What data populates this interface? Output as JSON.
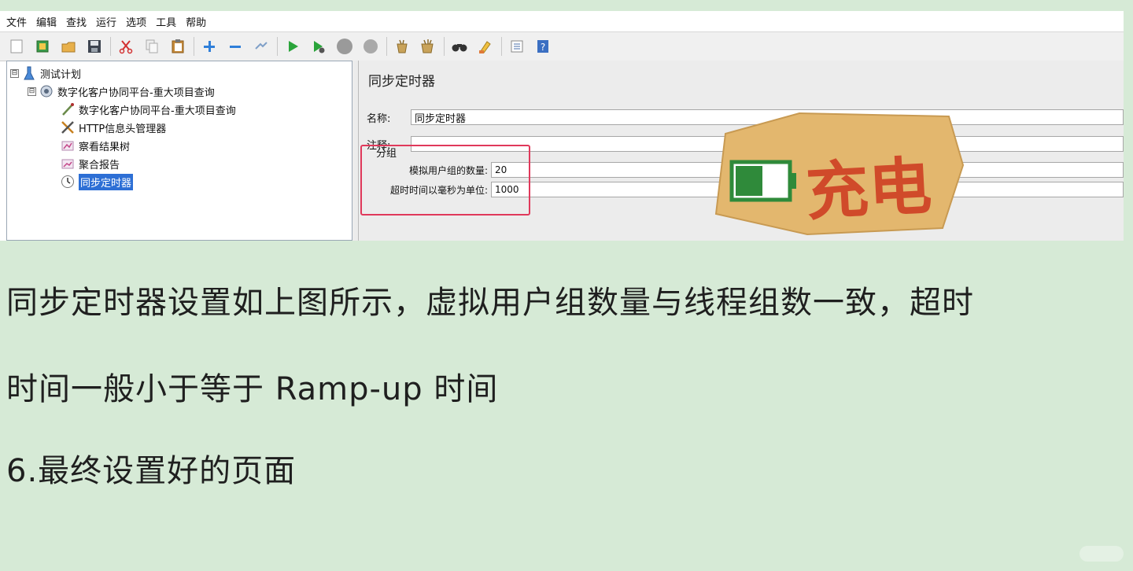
{
  "menu": [
    "文件",
    "编辑",
    "查找",
    "运行",
    "选项",
    "工具",
    "帮助"
  ],
  "toolbar_icons": [
    "new-icon",
    "templates-icon",
    "open-icon",
    "save-icon",
    "cut-icon",
    "copy-icon",
    "paste-icon",
    "expand-icon",
    "collapse-icon",
    "toggle-icon",
    "start-icon",
    "start-no-pause-icon",
    "stop-icon",
    "shutdown-icon",
    "clear-icon",
    "clear-all-icon",
    "search-icon",
    "reset-search-icon",
    "function-helper-icon",
    "help-icon"
  ],
  "tree": {
    "items": [
      {
        "label": "测试计划",
        "icon": "test-plan-icon",
        "expander": "⊟"
      },
      {
        "label": "数字化客户协同平台-重大项目查询",
        "icon": "thread-group-icon",
        "expander": "⊟"
      },
      {
        "label": "数字化客户协同平台-重大项目查询",
        "icon": "http-sampler-icon"
      },
      {
        "label": "HTTP信息头管理器",
        "icon": "header-manager-icon"
      },
      {
        "label": "察看结果树",
        "icon": "results-tree-icon"
      },
      {
        "label": "聚合报告",
        "icon": "aggregate-report-icon"
      },
      {
        "label": "同步定时器",
        "icon": "timer-icon",
        "selected": true
      }
    ]
  },
  "editor": {
    "title": "同步定时器",
    "name_label": "名称:",
    "name_value": "同步定时器",
    "comment_label": "注释:",
    "comment_value": "",
    "group_title": "分组",
    "num_users_label": "模拟用户组的数量:",
    "num_users_value": "20",
    "timeout_label": "超时时间以毫秒为单位:",
    "timeout_value": "1000"
  },
  "sticker": {
    "text": "充电",
    "battery_color": "#2f8a3a",
    "text_color": "#d04a2a"
  },
  "caption": {
    "line1": "同步定时器设置如上图所示，虚拟用户组数量与线程组数一致，超时",
    "line2": "时间一般小于等于 Ramp-up 时间",
    "line3": "6.最终设置好的页面"
  },
  "colors": {
    "background": "#d6ead6",
    "highlight": "#e0395b",
    "selection": "#2d6fd5"
  }
}
